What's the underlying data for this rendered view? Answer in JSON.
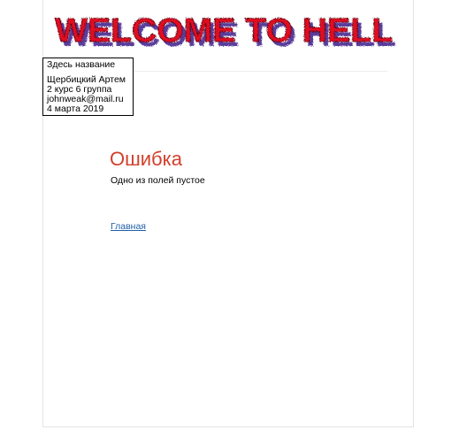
{
  "header": {
    "logo_text": "WELCOME TO HELL",
    "colors": {
      "logo_fill": "#e01020",
      "logo_shadow": "#3a1a8a"
    }
  },
  "info_box": {
    "title": "Здесь название",
    "author": "Щербицкий Артем",
    "group": "2 курс 6 группа",
    "email": "johnweak@mail.ru",
    "date": "4 марта 2019"
  },
  "main": {
    "heading": "Ошибка",
    "message": "Одно из полей пустое",
    "home_link": "Главная",
    "colors": {
      "heading": "#d1402c",
      "link": "#1f5fa8"
    }
  }
}
